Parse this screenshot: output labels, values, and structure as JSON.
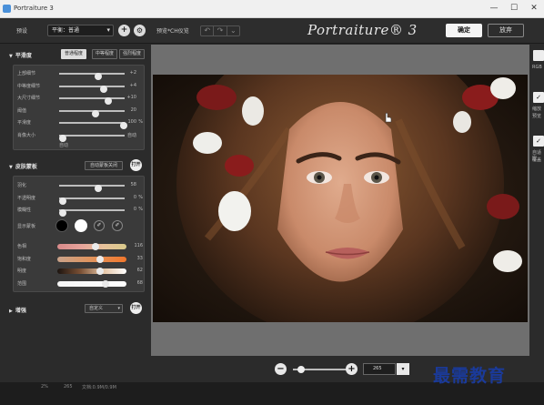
{
  "window": {
    "title": "Portraiture 3",
    "minimize": "—",
    "maximize": "☐",
    "close": "✕"
  },
  "toolbar": {
    "preset_label": "预设",
    "preset_value": "平衡：普通",
    "add_icon": "+",
    "settings_icon": "⚙",
    "preview_label": "预览*CH仪览",
    "undo_icons": [
      "↶",
      "↷",
      "⌄"
    ],
    "logo": "Portraiture® 3",
    "ok_label": "确定",
    "cancel_label": "放弃"
  },
  "smoothing": {
    "title": "平滑度",
    "tabs": [
      {
        "label": "普通程度",
        "active": true
      },
      {
        "label": "中等程度",
        "active": false
      },
      {
        "label": "强烈程度",
        "active": false
      }
    ],
    "sliders": [
      {
        "label": "上部细节",
        "value": "+2",
        "unit": "",
        "pos": 0.6
      },
      {
        "label": "中等度细节",
        "value": "+4",
        "unit": "",
        "pos": 0.68
      },
      {
        "label": "大尺寸细节",
        "value": "+10",
        "unit": "",
        "pos": 0.75
      },
      {
        "label": "阈值",
        "value": "20",
        "unit": "",
        "pos": 0.55
      },
      {
        "label": "平滑度",
        "value": "100",
        "unit": "%",
        "pos": 0.98
      },
      {
        "label": "肖像大小",
        "value": "自动",
        "unit": "",
        "pos": 0.05
      }
    ],
    "note": "自动"
  },
  "skin_mask": {
    "title": "皮肤蒙板",
    "auto_button": "自动蒙板关闭",
    "toggle": "打开",
    "sliders": [
      {
        "label": "羽化",
        "value": "58",
        "unit": "",
        "pos": 0.6
      },
      {
        "label": "不透明度",
        "value": "0",
        "unit": "%",
        "pos": 0.05
      },
      {
        "label": "模糊性",
        "value": "0",
        "unit": "%",
        "pos": 0.05
      }
    ],
    "show_mask_label": "显示蒙板",
    "swatches": {
      "black": "#000000",
      "white": "#ffffff"
    },
    "pick_icons": [
      "✐",
      "✐"
    ],
    "color_sliders": [
      {
        "label": "色相",
        "value": "116",
        "pos": 0.55
      },
      {
        "label": "饱和度",
        "value": "33",
        "pos": 0.62
      },
      {
        "label": "明度",
        "value": "62",
        "pos": 0.62
      },
      {
        "label": "范围",
        "value": "68",
        "pos": 0.7
      }
    ]
  },
  "enhance": {
    "title": "增强",
    "select_value": "自定义",
    "toggle": "打开"
  },
  "zoom": {
    "minus": "−",
    "plus": "+",
    "value": "265",
    "dropdown": "▾",
    "pos": 0.15
  },
  "right_panel": {
    "texts": [
      "RGB",
      "缩放",
      "预览",
      "自适应",
      "覆盖"
    ]
  },
  "status": [
    "2%",
    "265",
    "文档:0.9M/0.9M"
  ],
  "watermark": "最需教育"
}
